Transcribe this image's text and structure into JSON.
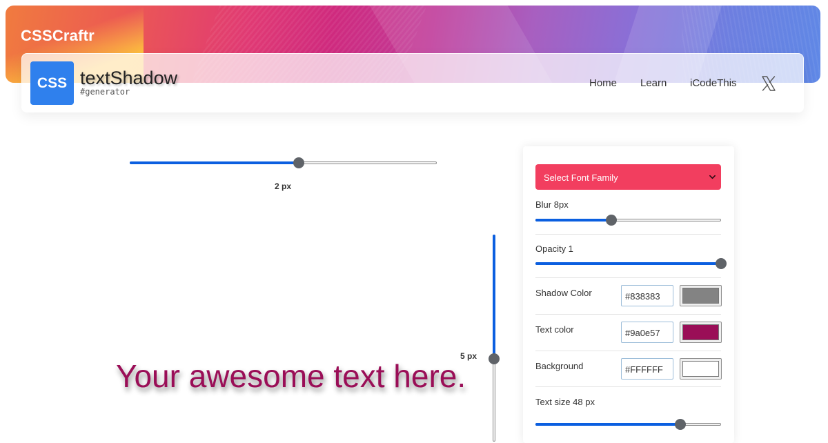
{
  "banner": {
    "brand": "CSSCraftr"
  },
  "header": {
    "logo_text": "CSS",
    "title": "textShadow",
    "subtitle": "#generator",
    "nav": [
      {
        "label": "Home"
      },
      {
        "label": "Learn"
      },
      {
        "label": "iCodeThis"
      }
    ],
    "social_icon": "x-twitter-icon"
  },
  "preview": {
    "text": "Your awesome text here.",
    "offset_x": {
      "label": "2 px",
      "value": 2,
      "fraction": 0.55
    },
    "offset_y": {
      "label": "5 px",
      "value": 5,
      "fraction": 0.6
    }
  },
  "controls": {
    "font_select": {
      "value": "Select Font Family"
    },
    "blur": {
      "label": "Blur 8px",
      "value": 8,
      "fraction": 0.41
    },
    "opacity": {
      "label": "Opacity 1",
      "value": 1,
      "fraction": 1.0
    },
    "shadow_color": {
      "label": "Shadow Color",
      "hex": "#838383",
      "color": "#838383"
    },
    "text_color": {
      "label": "Text color",
      "hex": "#9a0e57",
      "color": "#9a0e57"
    },
    "background": {
      "label": "Background",
      "hex": "#FFFFFF",
      "color": "#FFFFFF"
    },
    "text_size": {
      "label": "Text size 48 px",
      "value": 48,
      "fraction": 0.78
    }
  },
  "colors": {
    "accent": "#0b5fe0",
    "select_bg": "#f23e5f",
    "logo_bg": "#2f80ed"
  }
}
